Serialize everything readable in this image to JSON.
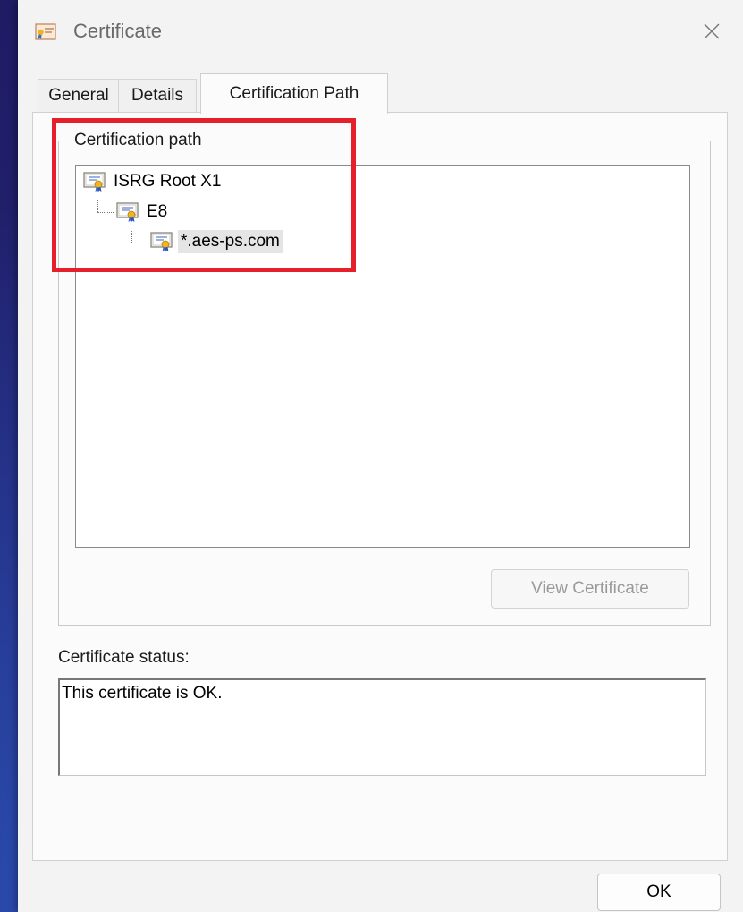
{
  "window": {
    "title": "Certificate",
    "close_icon": "close-icon"
  },
  "tabs": [
    {
      "label": "General",
      "active": false
    },
    {
      "label": "Details",
      "active": false
    },
    {
      "label": "Certification Path",
      "active": true
    }
  ],
  "certification_path": {
    "group_label": "Certification path",
    "nodes": [
      {
        "label": "ISRG Root X1",
        "icon": "certificate-icon",
        "level": 0,
        "selected": false
      },
      {
        "label": "E8",
        "icon": "certificate-icon",
        "level": 1,
        "selected": false
      },
      {
        "label": "*.aes-ps.com",
        "icon": "certificate-icon",
        "level": 2,
        "selected": true
      }
    ],
    "view_button_label": "View Certificate",
    "view_button_enabled": false
  },
  "status": {
    "label": "Certificate status:",
    "text": "This certificate is OK."
  },
  "footer": {
    "ok_label": "OK"
  },
  "colors": {
    "highlight_box": "#e5202a",
    "desktop_bg": "#23206b",
    "dialog_bg": "#f3f3f3",
    "selected_bg": "#e5e5e5"
  }
}
